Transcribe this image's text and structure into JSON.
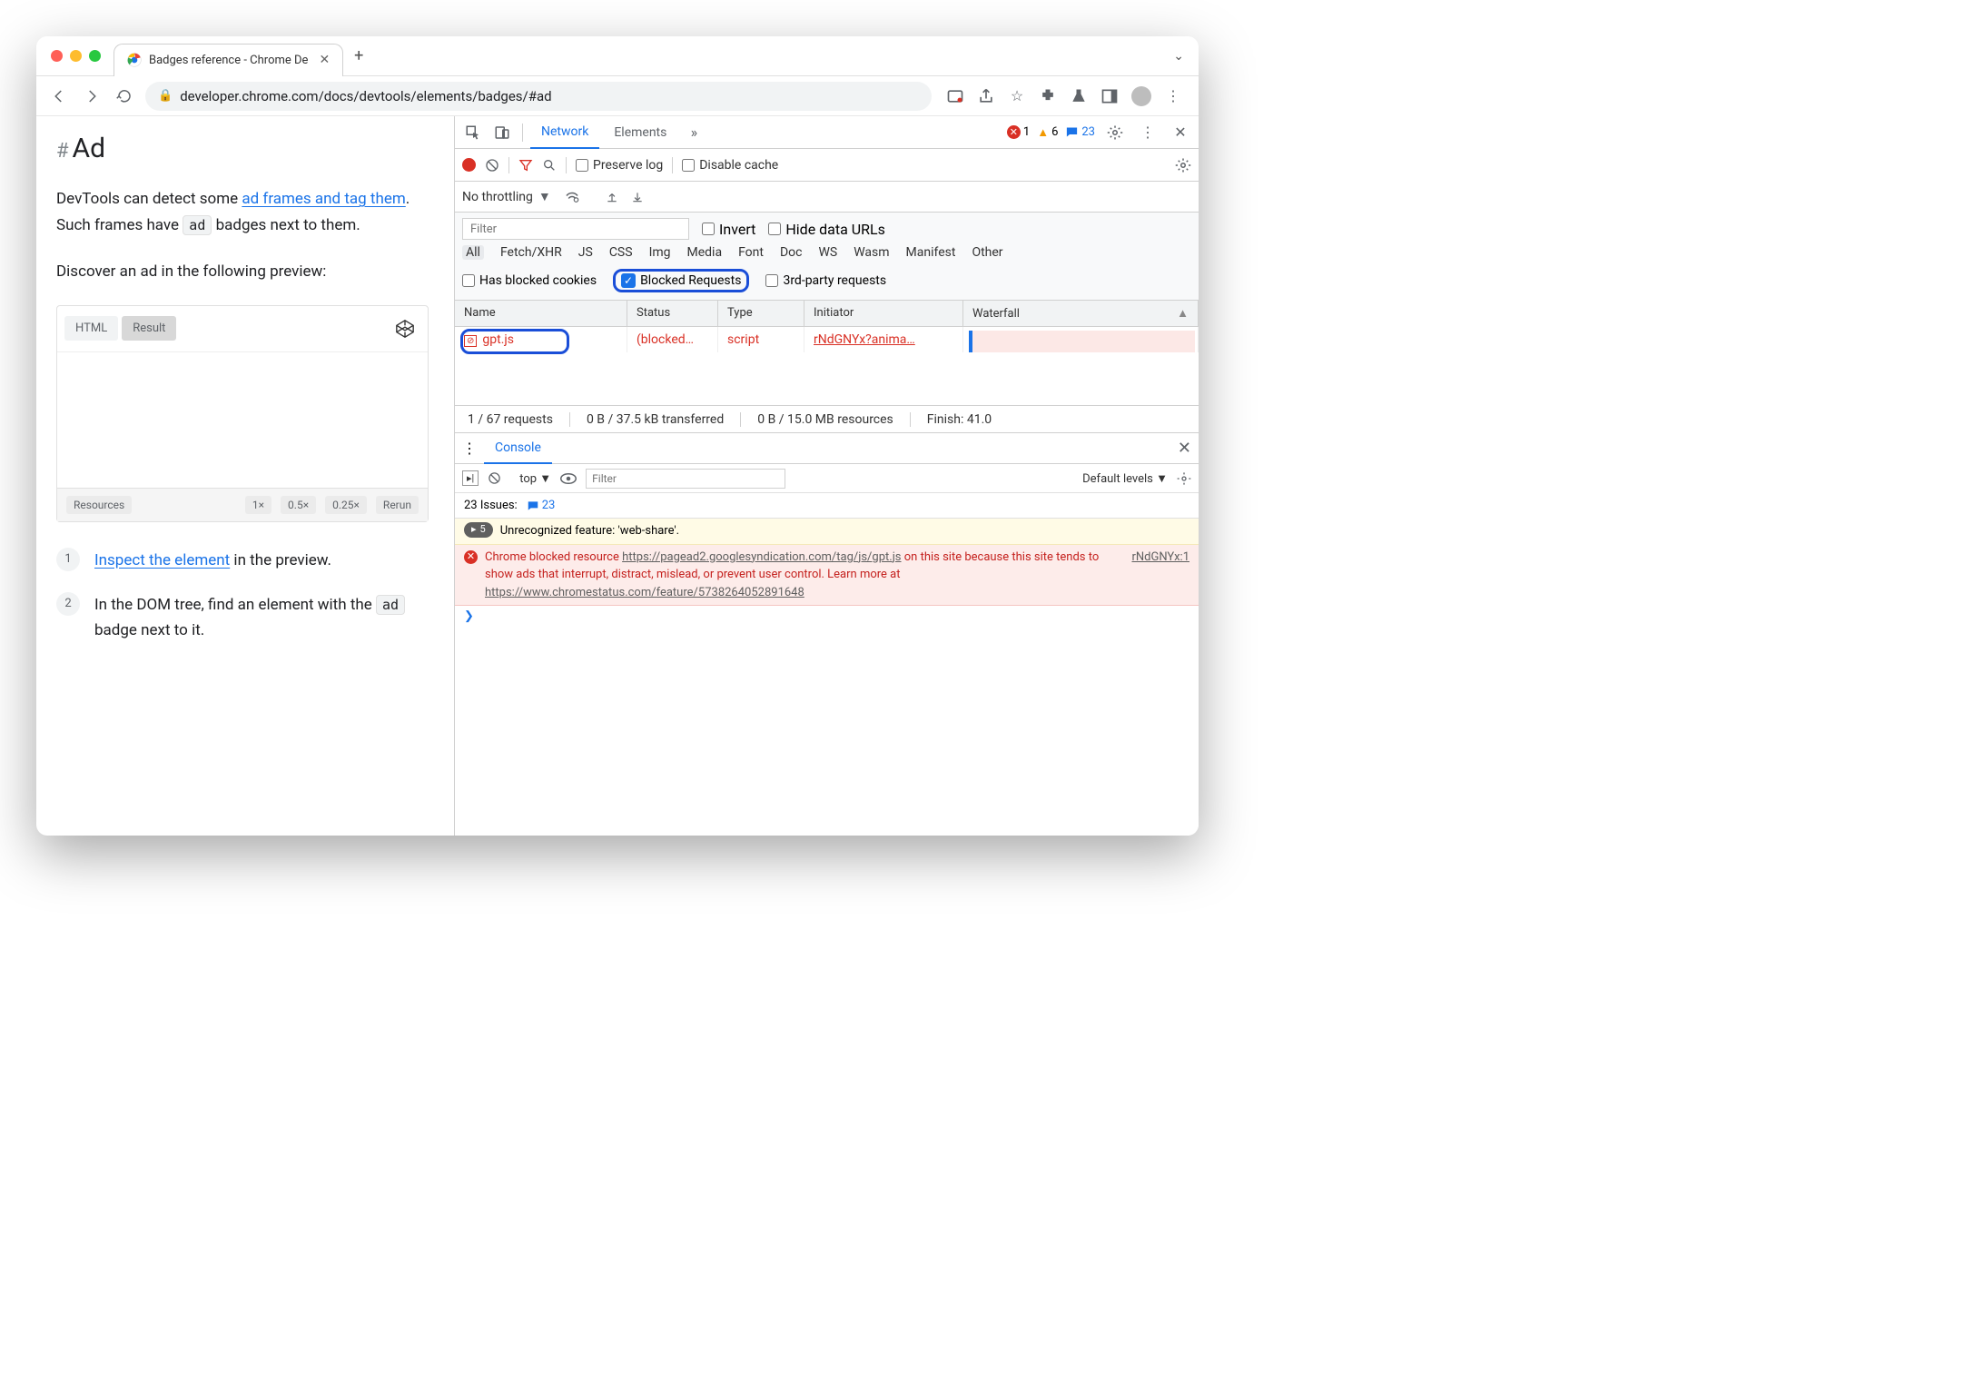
{
  "browser": {
    "tab_title": "Badges reference - Chrome De",
    "url": "developer.chrome.com/docs/devtools/elements/badges/#ad"
  },
  "page": {
    "heading": "Ad",
    "p1_pre": "DevTools can detect some ",
    "p1_link": "ad frames and tag them",
    "p1_post": ". Such frames have ",
    "p1_code": "ad",
    "p1_end": " badges next to them.",
    "p2": "Discover an ad in the following preview:",
    "preview": {
      "t1": "HTML",
      "t2": "Result",
      "f1": "Resources",
      "z1": "1×",
      "z05": "0.5×",
      "z025": "0.25×",
      "rerun": "Rerun"
    },
    "step1_link": "Inspect the element",
    "step1_post": " in the preview.",
    "step2_pre": "In the DOM tree, find an element with the ",
    "step2_code": "ad",
    "step2_post": " badge next to it."
  },
  "devtools": {
    "tabs": {
      "network": "Network",
      "elements": "Elements"
    },
    "counts": {
      "errors": "1",
      "warnings": "6",
      "issues": "23"
    },
    "network_toolbar": {
      "preserve": "Preserve log",
      "disable_cache": "Disable cache",
      "throttling": "No throttling"
    },
    "filter": {
      "placeholder": "Filter",
      "invert": "Invert",
      "hide_urls": "Hide data URLs",
      "types": [
        "All",
        "Fetch/XHR",
        "JS",
        "CSS",
        "Img",
        "Media",
        "Font",
        "Doc",
        "WS",
        "Wasm",
        "Manifest",
        "Other"
      ],
      "blocked_cookies": "Has blocked cookies",
      "blocked_requests": "Blocked Requests",
      "third_party": "3rd-party requests"
    },
    "columns": {
      "name": "Name",
      "status": "Status",
      "type": "Type",
      "initiator": "Initiator",
      "waterfall": "Waterfall"
    },
    "row": {
      "name": "gpt.js",
      "status": "(blocked…",
      "type": "script",
      "initiator": "rNdGNYx?anima…"
    },
    "status_bar": {
      "requests": "1 / 67 requests",
      "transferred": "0 B / 37.5 kB transferred",
      "resources": "0 B / 15.0 MB resources",
      "finish": "Finish: 41.0"
    },
    "console": {
      "label": "Console",
      "top": "top",
      "filter_placeholder": "Filter",
      "levels": "Default levels",
      "issues_label": "23 Issues:",
      "issues_count": "23",
      "warn_pill": "5",
      "warn_text": "Unrecognized feature: 'web-share'.",
      "err_pre": "Chrome blocked resource ",
      "err_url1": "https://pagead2.googlesyndication.com/tag/js/gpt.js",
      "err_mid": " on this site because this site tends to show ads that interrupt, distract, mislead, or prevent user control. Learn more at ",
      "err_url2": "https://www.chromestatus.com/feature/5738264052891648",
      "err_src": "rNdGNYx:1"
    }
  }
}
